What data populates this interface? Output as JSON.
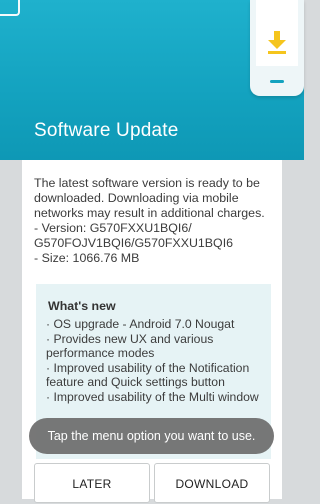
{
  "header": {
    "title": "Software Update",
    "accent_color": "#13a2bf",
    "illustration_icon": "phone-download-icon"
  },
  "content": {
    "intro": "The latest software version is ready to be downloaded. Downloading via mobile networks may result in additional charges.",
    "version_line1": "- Version: G570FXXU1BQI6/",
    "version_line2": "G570FOJV1BQI6/G570FXXU1BQI6",
    "size": "- Size: 1066.76 MB"
  },
  "whats_new": {
    "heading": "What's new",
    "items": [
      "· OS upgrade - Android 7.0 Nougat",
      "· Provides new UX and various performance modes",
      "· Improved usability of the Notification feature and Quick settings button",
      "· Improved usability of the Multi window"
    ]
  },
  "toast": "Tap the menu option you want to use.",
  "buttons": {
    "later": "LATER",
    "download": "DOWNLOAD"
  }
}
